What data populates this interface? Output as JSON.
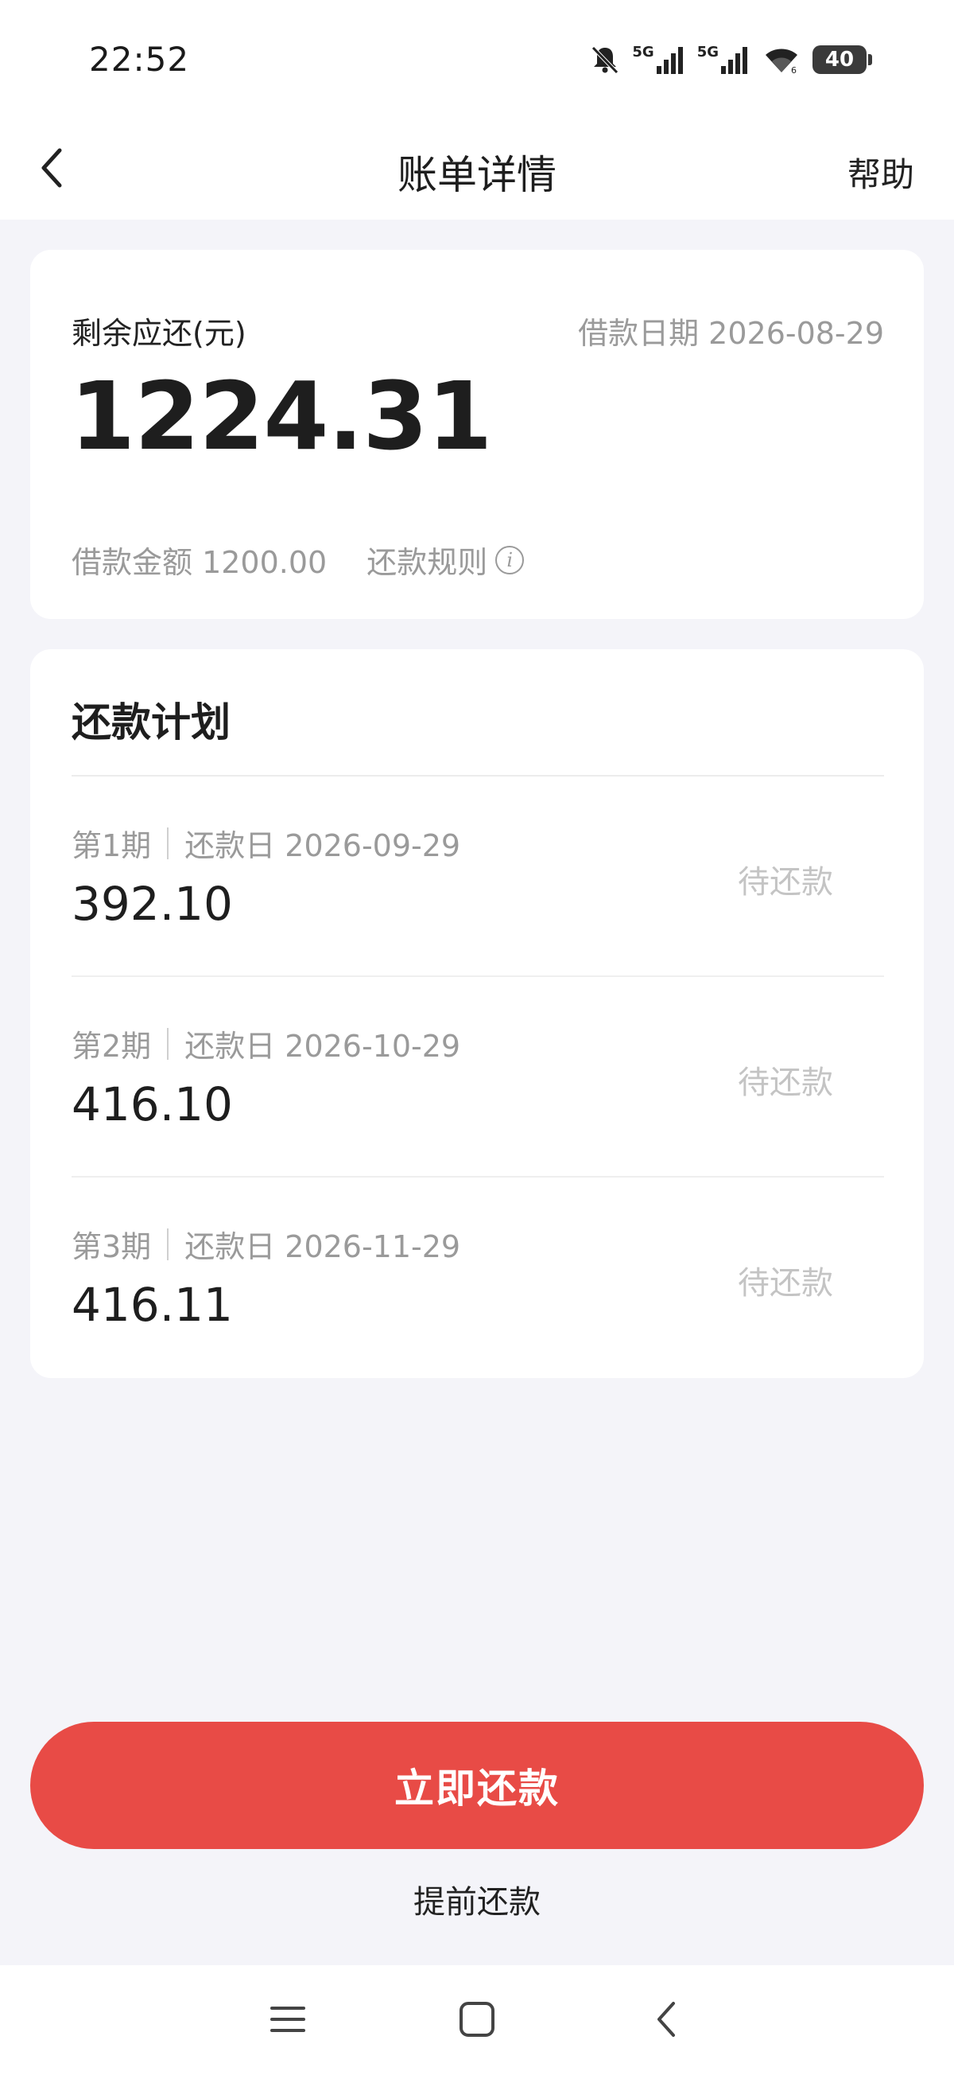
{
  "status_bar": {
    "time": "22:52",
    "network_1": "5G",
    "network_2": "5G",
    "battery": "40",
    "icons": [
      "mute-bell-icon",
      "signal-icon",
      "signal-icon",
      "wifi-icon",
      "battery-icon"
    ]
  },
  "nav": {
    "title": "账单详情",
    "help_label": "帮助",
    "back_icon": "chevron-left-icon"
  },
  "summary": {
    "remaining_label": "剩余应还(元)",
    "loan_date": "借款日期 2026-08-29",
    "remaining_amount": "1224.31",
    "loan_amount": "借款金额 1200.00",
    "rules_label": "还款规则",
    "rules_icon": "info-icon"
  },
  "plan": {
    "title": "还款计划",
    "rows": [
      {
        "period": "第1期",
        "due": "还款日 2026-09-29",
        "amount": "392.10",
        "status": "待还款"
      },
      {
        "period": "第2期",
        "due": "还款日 2026-10-29",
        "amount": "416.10",
        "status": "待还款"
      },
      {
        "period": "第3期",
        "due": "还款日 2026-11-29",
        "amount": "416.11",
        "status": "待还款"
      }
    ]
  },
  "actions": {
    "pay_now_label": "立即还款",
    "prepay_label": "提前还款",
    "pay_now_color": "#e84b46"
  },
  "system_nav": {
    "icons": [
      "menu-icon",
      "home-icon",
      "back-icon"
    ]
  }
}
